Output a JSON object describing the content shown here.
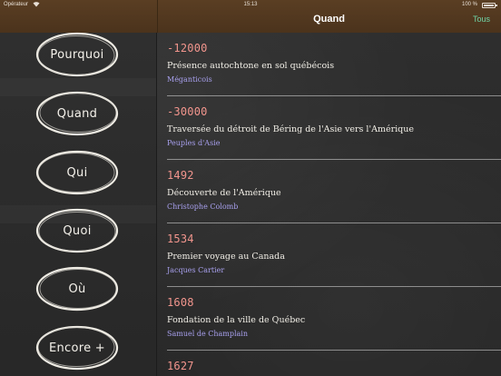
{
  "status_bar": {
    "carrier": "Opérateur",
    "time": "15:13",
    "battery": "100 %"
  },
  "nav": {
    "title": "Quand",
    "all_label": "Tous"
  },
  "sidebar": {
    "items": [
      {
        "label": "Pourquoi"
      },
      {
        "label": "Quand"
      },
      {
        "label": "Qui"
      },
      {
        "label": "Quoi"
      },
      {
        "label": "Où"
      },
      {
        "label": "Encore +"
      }
    ]
  },
  "timeline": {
    "rows": [
      {
        "year": "-12000",
        "event": "Présence autochtone en sol québécois",
        "person": "Méganticois"
      },
      {
        "year": "-30000",
        "event": "Traversée du détroit de Béring de l'Asie vers l'Amérique",
        "person": "Peuples d'Asie"
      },
      {
        "year": "1492",
        "event": "Découverte de l'Amérique",
        "person": "Christophe Colomb"
      },
      {
        "year": "1534",
        "event": "Premier voyage au Canada",
        "person": "Jacques Cartier"
      },
      {
        "year": "1608",
        "event": "Fondation de la ville de Québec",
        "person": "Samuel de Champlain"
      },
      {
        "year": "1627",
        "event": "",
        "person": ""
      }
    ]
  },
  "colors": {
    "header": "#4f361e",
    "accent": "#6fd4a6",
    "year": "#f2958d",
    "person": "#a8a0ee",
    "chalk": "#f4f1ea"
  }
}
